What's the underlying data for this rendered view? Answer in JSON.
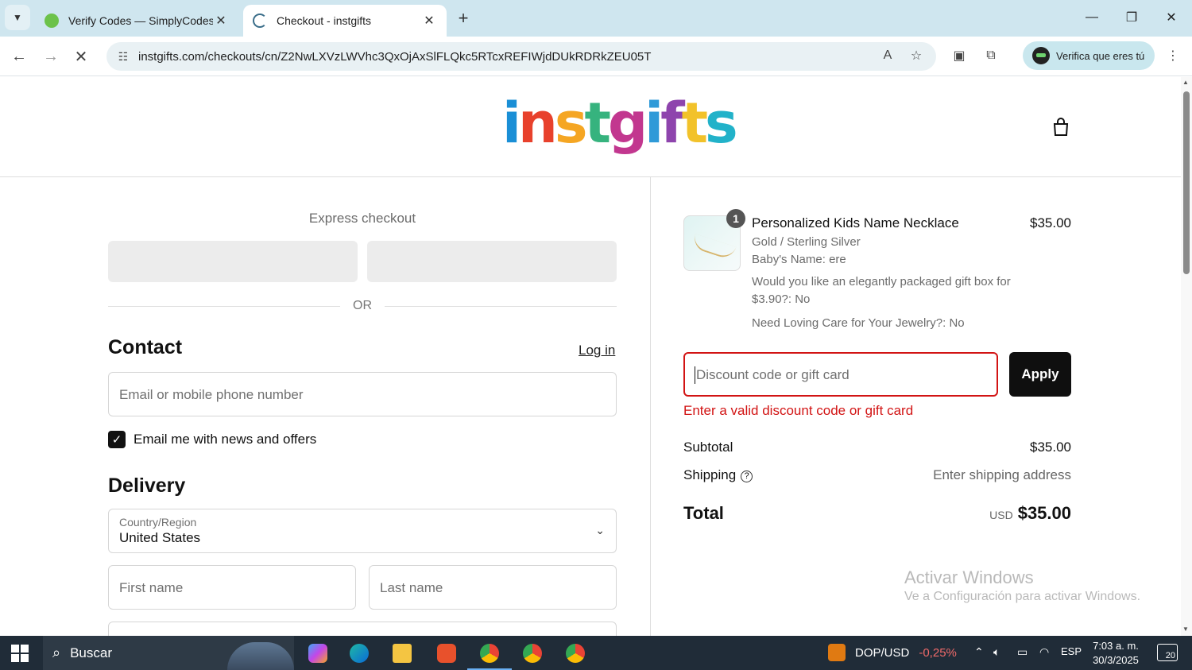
{
  "browser": {
    "tabs": [
      {
        "title": "Verify Codes — SimplyCodes",
        "favicon": "simplycodes-icon",
        "active": false
      },
      {
        "title": "Checkout - instgifts",
        "favicon": "loading-icon",
        "active": true
      }
    ],
    "url": "instgifts.com/checkouts/cn/Z2NwLXVzLWVhc3QxOjAxSlFLQkc5RTcxREFIWjdDUkRDRkZEU05T",
    "profile_button": "Verifica que eres tú"
  },
  "header": {
    "logo_text": "instgifts",
    "logo_colors": [
      "#1a8fd6",
      "#e8412c",
      "#f5a623",
      "#36b37e",
      "#c2378f",
      "#2f9ad8",
      "#8e44ad",
      "#f2c22a",
      "#22b2c9"
    ]
  },
  "checkout": {
    "express_label": "Express checkout",
    "or_label": "OR",
    "contact": {
      "heading": "Contact",
      "login_label": "Log in",
      "email_placeholder": "Email or mobile phone number",
      "newsletter_label": "Email me with news and offers",
      "newsletter_checked": true
    },
    "delivery": {
      "heading": "Delivery",
      "country_label": "Country/Region",
      "country_value": "United States",
      "first_name_placeholder": "First name",
      "last_name_placeholder": "Last name"
    }
  },
  "summary": {
    "item": {
      "quantity": "1",
      "name": "Personalized Kids Name Necklace",
      "price": "$35.00",
      "variant": "Gold / Sterling Silver",
      "baby_name": "Baby's Name: ere",
      "gift_box": "Would you like an elegantly packaged gift box for $3.90?: No",
      "care": "Need Loving Care for Your Jewelry?: No"
    },
    "discount_placeholder": "Discount code or gift card",
    "apply_label": "Apply",
    "discount_error": "Enter a valid discount code or gift card",
    "subtotal_label": "Subtotal",
    "subtotal_value": "$35.00",
    "shipping_label": "Shipping",
    "shipping_value": "Enter shipping address",
    "total_label": "Total",
    "total_currency": "USD",
    "total_value": "$35.00"
  },
  "watermark": {
    "line1": "Activar Windows",
    "line2": "Ve a Configuración para activar Windows."
  },
  "taskbar": {
    "search_label": "Buscar",
    "ticker_label": "DOP/USD",
    "ticker_change": "-0,25%",
    "language": "ESP",
    "time": "7:03 a. m.",
    "date": "30/3/2025",
    "notifications": "20"
  },
  "colors": {
    "error": "#d21414",
    "apply_bg": "#0f0f0f",
    "tabstrip_bg": "#cfe6ef"
  }
}
